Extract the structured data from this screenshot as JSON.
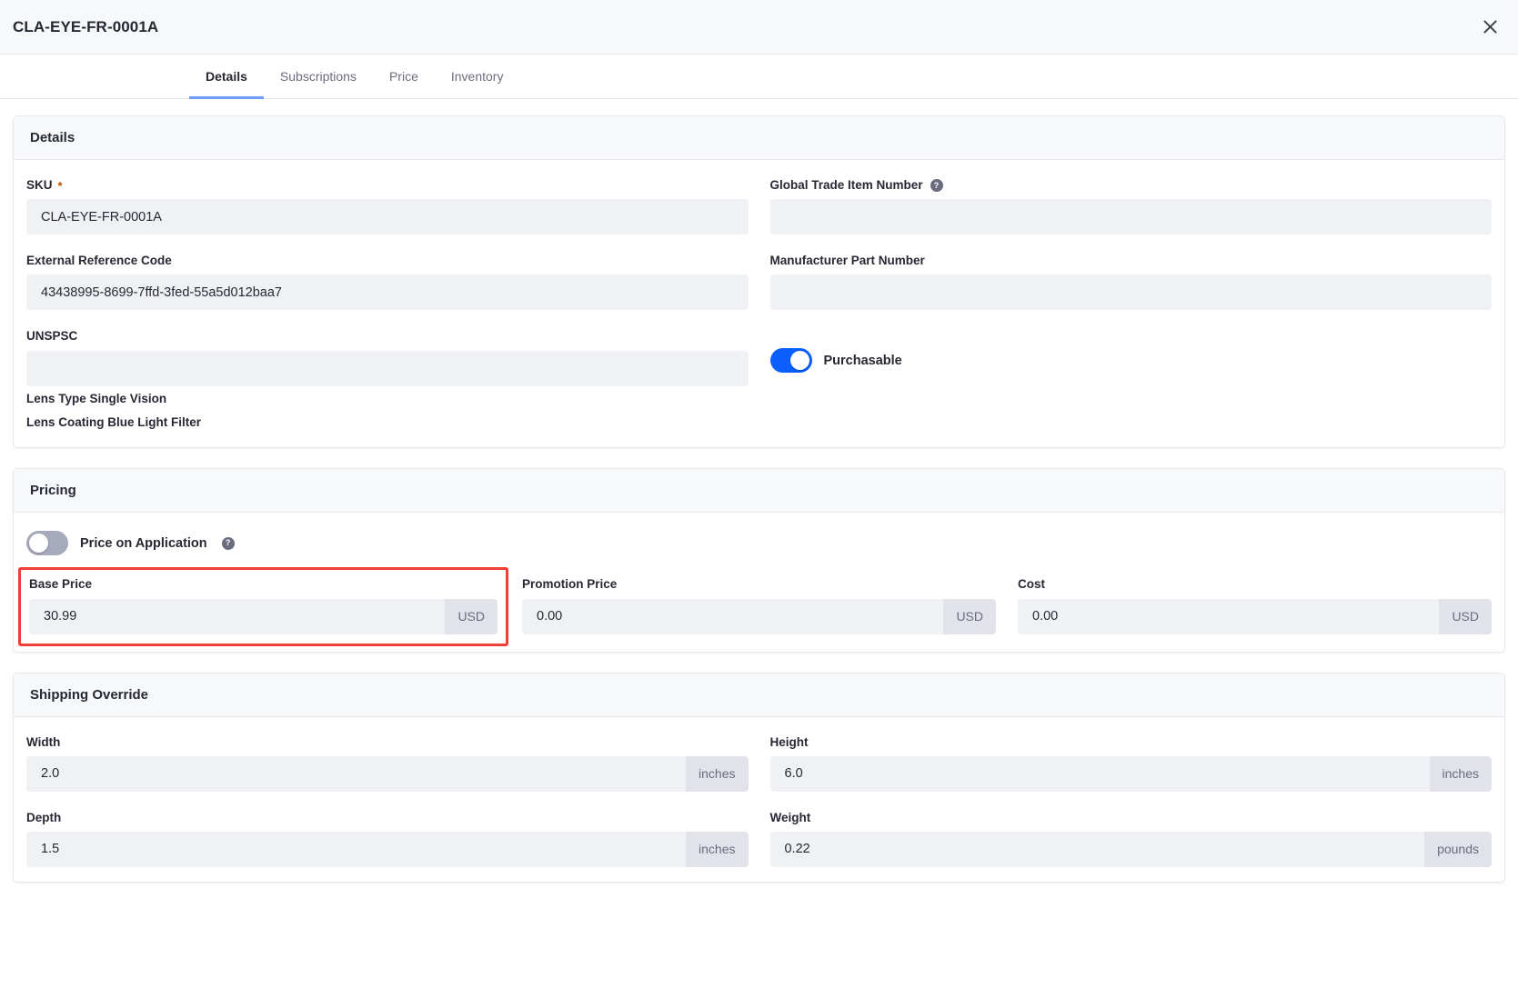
{
  "modal": {
    "title": "CLA-EYE-FR-0001A",
    "close_label": "Close"
  },
  "tabs": [
    {
      "label": "Details",
      "active": true
    },
    {
      "label": "Subscriptions",
      "active": false
    },
    {
      "label": "Price",
      "active": false
    },
    {
      "label": "Inventory",
      "active": false
    }
  ],
  "details": {
    "section_title": "Details",
    "sku": {
      "label": "SKU",
      "required_marker": "*",
      "value": "CLA-EYE-FR-0001A",
      "placeholder": ""
    },
    "gtin": {
      "label": "Global Trade Item Number",
      "help": "?",
      "value": "",
      "placeholder": ""
    },
    "external_reference_code": {
      "label": "External Reference Code",
      "value": "43438995-8699-7ffd-3fed-55a5d012baa7",
      "placeholder": ""
    },
    "manufacturer_part_number": {
      "label": "Manufacturer Part Number",
      "value": "",
      "placeholder": ""
    },
    "unspsc": {
      "label": "UNSPSC",
      "value": "",
      "placeholder": ""
    },
    "purchasable": {
      "label": "Purchasable",
      "state": "on"
    },
    "specifications": [
      {
        "key": "Lens Type",
        "value": "Single Vision"
      },
      {
        "key": "Lens Coating",
        "value": "Blue Light Filter"
      }
    ]
  },
  "pricing": {
    "section_title": "Pricing",
    "price_on_application": {
      "label": "Price on Application",
      "help": "?",
      "state": "off"
    },
    "base_price": {
      "label": "Base Price",
      "value": "30.99",
      "unit": "USD",
      "highlighted": true
    },
    "promotion_price": {
      "label": "Promotion Price",
      "value": "0.00",
      "unit": "USD"
    },
    "cost": {
      "label": "Cost",
      "value": "0.00",
      "unit": "USD"
    }
  },
  "shipping_override": {
    "section_title": "Shipping Override",
    "width": {
      "label": "Width",
      "value": "2.0",
      "unit": "inches"
    },
    "height": {
      "label": "Height",
      "value": "6.0",
      "unit": "inches"
    },
    "depth": {
      "label": "Depth",
      "value": "1.5",
      "unit": "inches"
    },
    "weight": {
      "label": "Weight",
      "value": "0.22",
      "unit": "pounds"
    }
  },
  "colors": {
    "accent": "#0b5fff",
    "tab_underline": "#6b9cf7",
    "highlight": "#ef4133",
    "required": "#b95000",
    "input_bg": "#f0f1f4",
    "unit_bg": "#e2e2ea",
    "header_bg": "#f7f8f9"
  }
}
